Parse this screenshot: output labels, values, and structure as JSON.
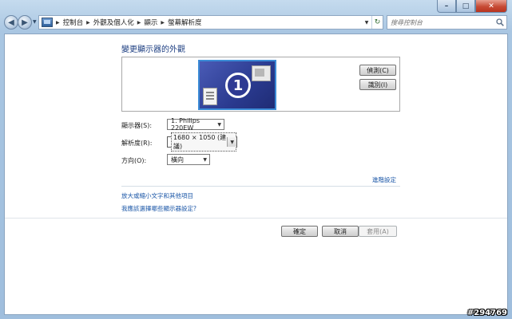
{
  "window": {
    "caption": {
      "minimize": "–",
      "maximize": "□",
      "close": "✕"
    }
  },
  "nav": {
    "back_glyph": "◀",
    "forward_glyph": "▶",
    "breadcrumbs": [
      "控制台",
      "外觀及個人化",
      "顯示",
      "螢幕解析度"
    ],
    "refresh_glyph": "↻"
  },
  "search": {
    "placeholder": "搜尋控制台"
  },
  "page": {
    "title": "變更顯示器的外觀",
    "monitor_number": "1",
    "detect_button": "偵測(C)",
    "identify_button": "識別(I)"
  },
  "fields": {
    "display": {
      "label": "顯示器(S):",
      "value": "1. Philips 220EW"
    },
    "resolution": {
      "label": "解析度(R):",
      "value": "1680 × 1050 (建議)"
    },
    "orientation": {
      "label": "方向(O):",
      "value": "橫向"
    }
  },
  "links": {
    "advanced": "進階設定",
    "text_size": "放大或縮小文字和其他項目",
    "which_settings": "我應該選擇哪些顯示器設定?"
  },
  "buttons": {
    "ok": "確定",
    "cancel": "取消",
    "apply": "套用(A)"
  },
  "watermark": "#294769",
  "colors": {
    "title": "#1e3f82",
    "link": "#1d58a8",
    "monitor": "#2a3a8f"
  }
}
